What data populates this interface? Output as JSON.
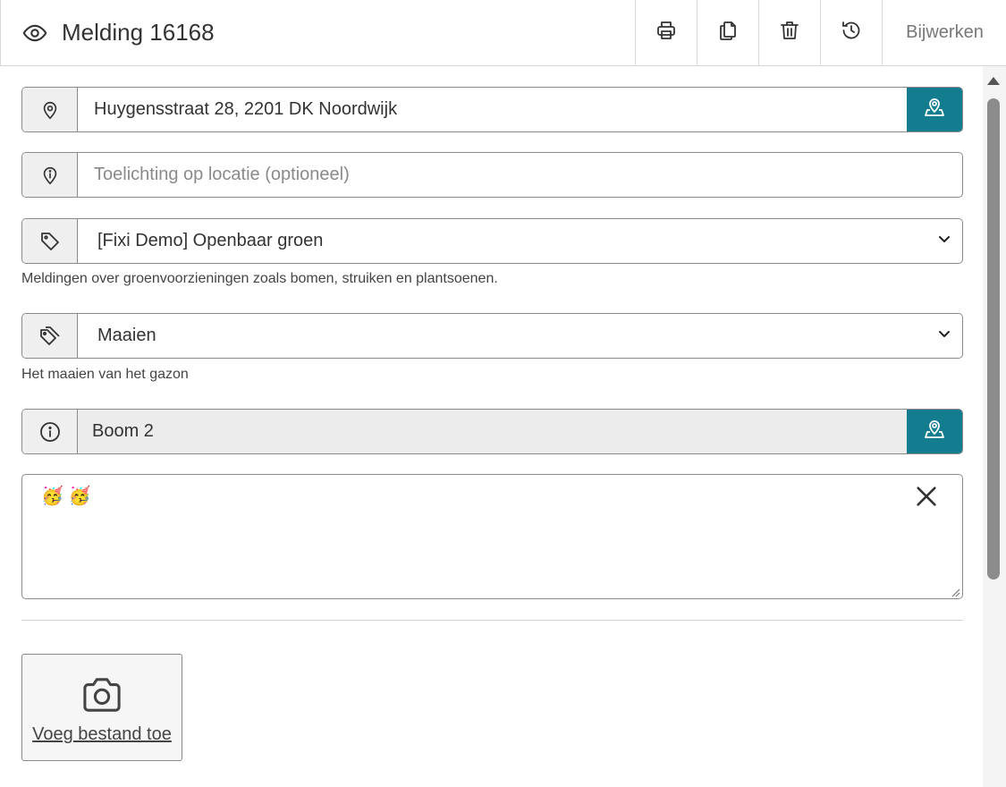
{
  "header": {
    "title": "Melding 16168",
    "update_label": "Bijwerken"
  },
  "form": {
    "address": {
      "value": "Huygensstraat 28, 2201 DK Noordwijk"
    },
    "location_note": {
      "placeholder": "Toelichting op locatie (optioneel)"
    },
    "category": {
      "selected": "[Fixi Demo] Openbaar groen",
      "help": "Meldingen over groenvoorzieningen zoals bomen, struiken en plantsoenen."
    },
    "subcategory": {
      "selected": "Maaien",
      "help": "Het maaien van het gazon"
    },
    "object": {
      "value": "Boom 2"
    },
    "description": {
      "value": "🥳 🥳"
    },
    "upload": {
      "label": "Voeg bestand toe"
    }
  },
  "colors": {
    "accent": "#137c8f",
    "border": "#8a8a8a",
    "addon_bg": "#efefef"
  },
  "icons": {
    "header": [
      "eye-icon",
      "print-icon",
      "copy-icon",
      "trash-icon",
      "history-icon"
    ],
    "fields": [
      "location-pin-icon",
      "info-pin-icon",
      "tag-icon",
      "tags-icon",
      "info-circle-icon",
      "map-marker-icon",
      "close-icon",
      "camera-icon"
    ]
  }
}
